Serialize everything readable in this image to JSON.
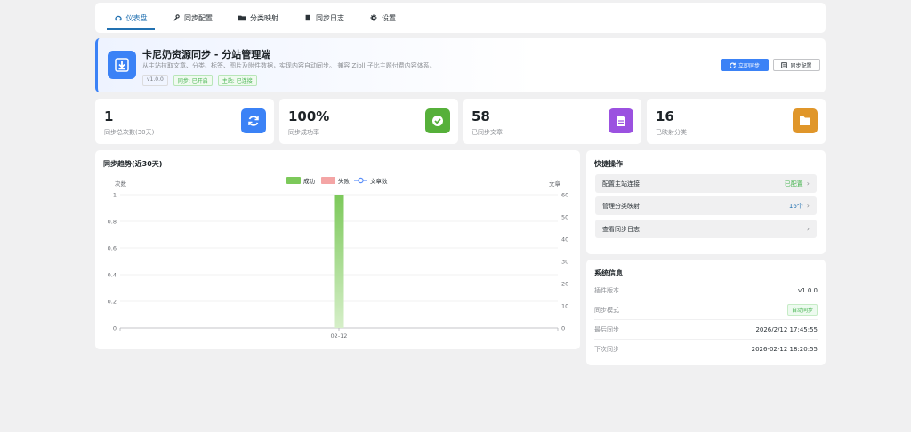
{
  "nav": {
    "tabs": [
      {
        "label": "仪表盘",
        "icon": "dashboard-icon",
        "active": true
      },
      {
        "label": "同步配置",
        "icon": "wrench-icon",
        "active": false
      },
      {
        "label": "分类映射",
        "icon": "folder-icon",
        "active": false
      },
      {
        "label": "同步日志",
        "icon": "document-icon",
        "active": false
      },
      {
        "label": "设置",
        "icon": "gear-icon",
        "active": false
      }
    ]
  },
  "hero": {
    "title": "卡尼奶资源同步 - 分站管理端",
    "description": "从主站拉取文章、分类、标签、图片及附件数据，实现内容自动同步。 兼容 Zibll 子比主题付费内容体系。",
    "badges": [
      "v1.0.0",
      "同步: 已开启",
      "主站: 已连接"
    ],
    "sync_now": "立即同步",
    "sync_config": "同步配置",
    "accent": "#3b82f6"
  },
  "stats": [
    {
      "value": "1",
      "label": "同步总次数(30天)",
      "color": "#3b82f6",
      "icon": "refresh-icon"
    },
    {
      "value": "100%",
      "label": "同步成功率",
      "color": "#56b03a",
      "icon": "check-circle-icon"
    },
    {
      "value": "58",
      "label": "已同步文章",
      "color": "#9b51e0",
      "icon": "document-icon"
    },
    {
      "value": "16",
      "label": "已映射分类",
      "color": "#e0962a",
      "icon": "folder-icon"
    }
  ],
  "chart": {
    "title": "同步趋势(近30天)",
    "legend": [
      "成功",
      "失败",
      "文章数"
    ],
    "left_axis_label": "次数",
    "right_axis_label": "文章"
  },
  "chart_data": {
    "type": "bar",
    "categories": [
      "02-12"
    ],
    "series": [
      {
        "name": "成功",
        "type": "bar",
        "values": [
          1
        ],
        "color": "#7cc95a"
      },
      {
        "name": "失败",
        "type": "bar",
        "values": [
          0
        ],
        "color": "#f4a5a5"
      },
      {
        "name": "文章数",
        "type": "line",
        "values": [
          0
        ],
        "color": "#5b8ff9",
        "axis": "right"
      }
    ],
    "ylim": [
      0,
      1
    ],
    "yticks": [
      "0",
      "0.2",
      "0.4",
      "0.6",
      "0.8",
      "1"
    ],
    "y2lim": [
      0,
      60
    ],
    "y2ticks": [
      "0",
      "10",
      "20",
      "30",
      "40",
      "50",
      "60"
    ],
    "ylabel": "次数",
    "y2label": "文章",
    "legend_position": "top-center",
    "grid": true
  },
  "quick_actions": {
    "title": "快捷操作",
    "items": [
      {
        "label": "配置主站连接",
        "value": "已配置",
        "tone": "green"
      },
      {
        "label": "管理分类映射",
        "value": "16个",
        "tone": "blue"
      },
      {
        "label": "查看同步日志",
        "value": "",
        "tone": ""
      }
    ]
  },
  "system": {
    "title": "系统信息",
    "rows": [
      {
        "key": "插件版本",
        "value": "v1.0.0"
      },
      {
        "key": "同步模式",
        "value": "自动同步"
      },
      {
        "key": "最后同步",
        "value": "2026/2/12 17:45:55"
      },
      {
        "key": "下次同步",
        "value": "2026-02-12 18:20:55"
      }
    ]
  }
}
